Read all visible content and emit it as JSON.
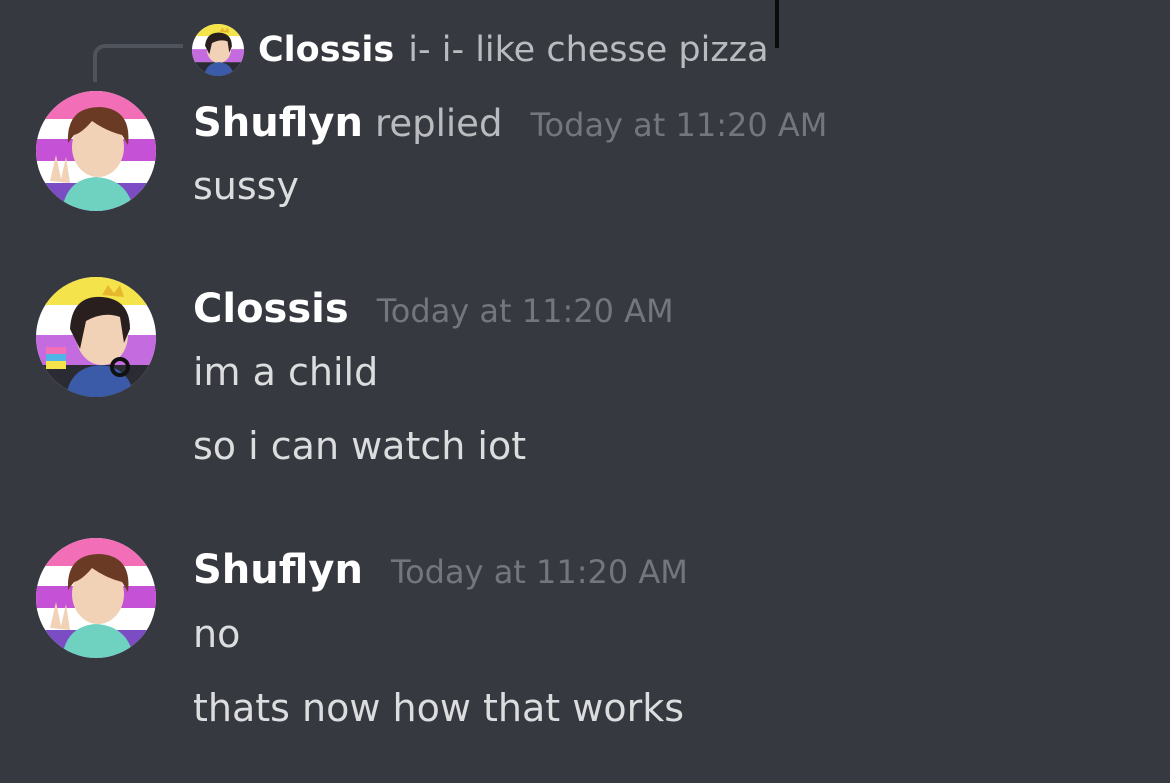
{
  "reply_reference": {
    "author": "Clossis",
    "content": "i- i- like chesse pizza"
  },
  "messages": [
    {
      "author": "Shuflyn",
      "replied_label": "replied",
      "timestamp": "Today at 11:20 AM",
      "lines": [
        "sussy"
      ]
    },
    {
      "author": "Clossis",
      "timestamp": "Today at 11:20 AM",
      "lines": [
        "im a child",
        "so i can watch iot"
      ]
    },
    {
      "author": "Shuflyn",
      "timestamp": "Today at 11:20 AM",
      "lines": [
        "no",
        "thats now how that works"
      ]
    }
  ],
  "colors": {
    "background": "#36393f",
    "username": "#ffffff",
    "message_text": "#dcddde",
    "timestamp": "#72767d",
    "pink": "#e34fbf",
    "purple": "#9b59d0",
    "yellow": "#f4e34a"
  }
}
